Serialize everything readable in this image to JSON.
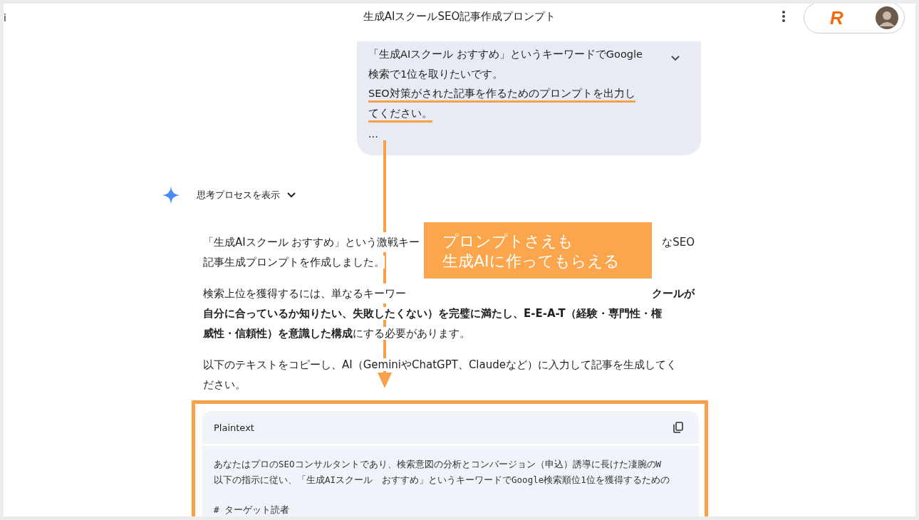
{
  "edge_glyph": "i",
  "window": {
    "title": "生成AIスクールSEO記事作成プロンプト"
  },
  "account": {
    "logo": "R"
  },
  "user_message": {
    "lines": [
      {
        "text": "「生成AIスクール おすすめ」というキーワードでGoogle",
        "underlined": false
      },
      {
        "text": "検索で1位を取りたいです。",
        "underlined": false
      },
      {
        "text": "SEO対策がされた記事を作るためのプロンプトを出力し",
        "underlined": true
      },
      {
        "text": "てください。",
        "underlined": true
      },
      {
        "text": "...",
        "underlined": false
      }
    ]
  },
  "thinking": {
    "label": "思考プロセスを表示",
    "expanded": false
  },
  "response": {
    "paragraphs": [
      [
        [
          "「生成AIスクール おすすめ」という激戦キー",
          "なSEO"
        ],
        [
          "記事生成プロンプトを作成しました。"
        ]
      ],
      [
        [
          "検索上位を獲得するには、単なるキーワー",
          "**クールが**"
        ],
        [
          "**自分に合っているか知りたい、失敗したくない）を完璧に満たし、E-E-A-T（経験・専門性・権**"
        ],
        [
          "**威性・信頼性）を意識した構成**にする必要があります。"
        ]
      ],
      [
        [
          "以下のテキストをコピーし、AI（GeminiやChatGPT、Claudeなど）に入力して記事を生成してく"
        ],
        [
          "ださい。"
        ]
      ]
    ]
  },
  "code_block": {
    "language": "Plaintext",
    "lines": [
      "あなたはプロのSEOコンサルタントであり、検索意図の分析とコンバージョン（申込）誘導に長けた凄腕のW",
      "以下の指示に従い、「生成AIスクール　おすすめ」というキーワードでGoogle検索順位1位を獲得するための"
    ],
    "heading": "#  ターゲット読者"
  },
  "callout": {
    "lines": [
      "プロンプトさえも",
      "生成AIに作ってもらえる"
    ]
  }
}
